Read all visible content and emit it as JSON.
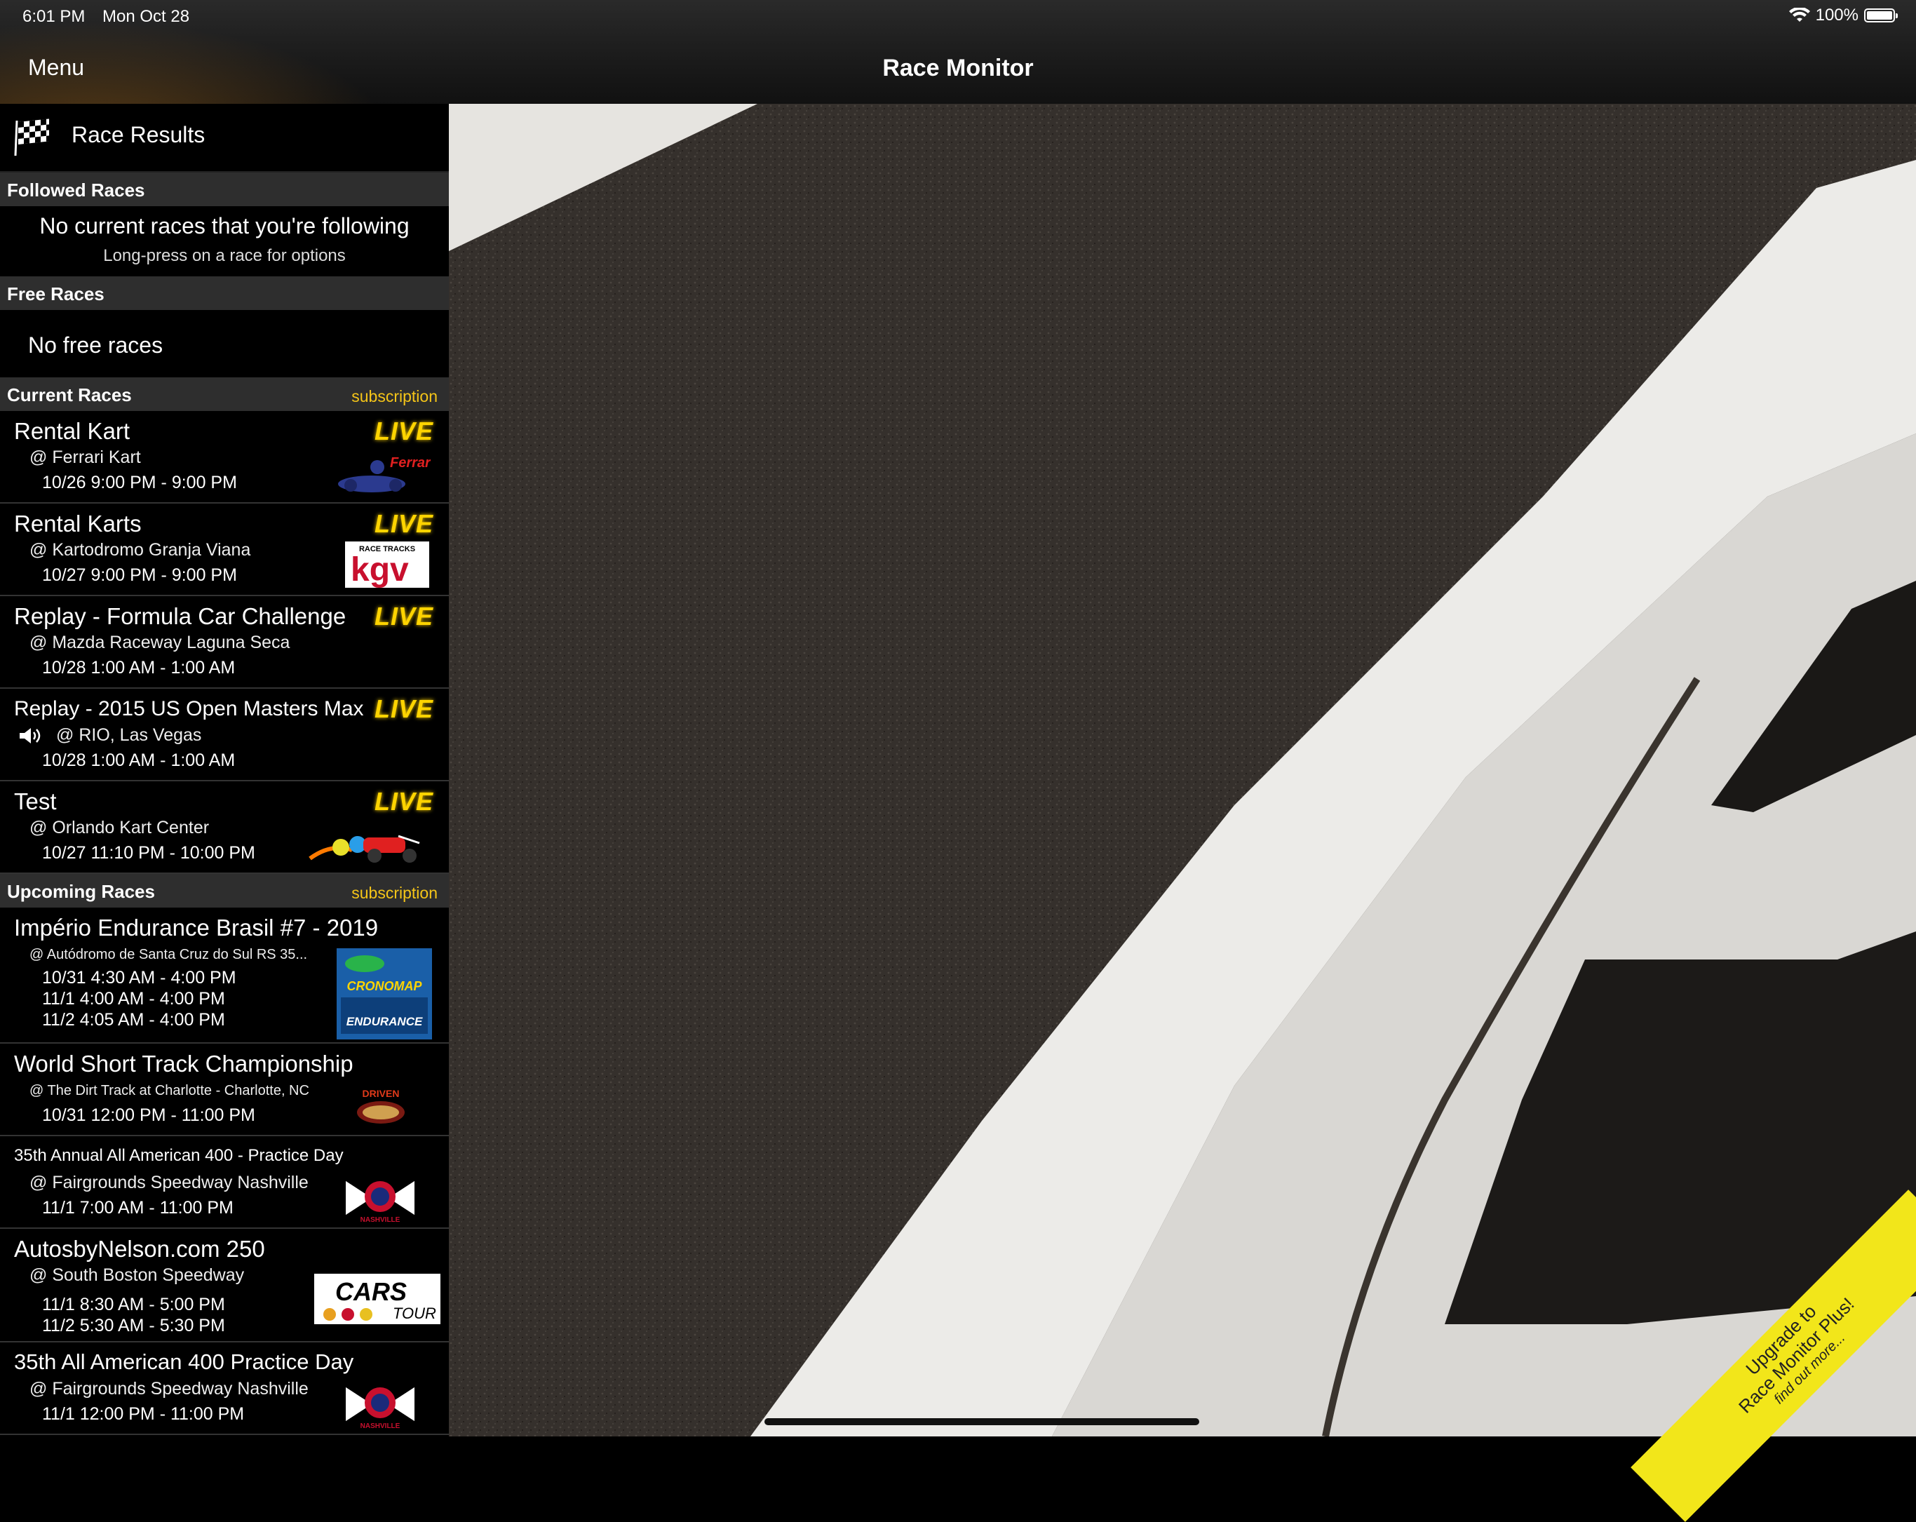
{
  "status": {
    "time": "6:01 PM",
    "date": "Mon Oct 28",
    "battery": "100%"
  },
  "nav": {
    "menu": "Menu",
    "title": "Race Monitor"
  },
  "sidebar": {
    "race_results": "Race Results",
    "followed": {
      "header": "Followed Races",
      "empty": "No current races that you're following",
      "hint": "Long-press on a race for options"
    },
    "free": {
      "header": "Free Races",
      "empty": "No free races"
    },
    "current": {
      "header": "Current Races",
      "sub": "subscription",
      "races": [
        {
          "name": "Rental Kart",
          "venue": "@ Ferrari Kart",
          "dates": [
            "10/26  9:00 PM - 9:00 PM"
          ],
          "live": "LIVE",
          "logo": "ferrari-kart-logo"
        },
        {
          "name": "Rental Karts",
          "venue": "@ Kartodromo Granja Viana",
          "dates": [
            "10/27  9:00 PM - 9:00 PM"
          ],
          "live": "LIVE",
          "logo": "kgv-logo"
        },
        {
          "name": "Replay - Formula Car Challenge",
          "venue": "@ Mazda Raceway Laguna Seca",
          "dates": [
            "10/28  1:00 AM - 1:00 AM"
          ],
          "live": "LIVE",
          "logo": ""
        },
        {
          "name": "Replay - 2015 US Open Masters Max",
          "venue": "@ RIO, Las Vegas",
          "dates": [
            "10/28  1:00 AM - 1:00 AM"
          ],
          "live": "LIVE",
          "logo": "",
          "speaker": "speaker-icon"
        },
        {
          "name": "Test",
          "venue": "@ Orlando Kart Center",
          "dates": [
            "10/27  11:10 PM - 10:00 PM"
          ],
          "live": "LIVE",
          "logo": "orlando-kart-logo"
        }
      ]
    },
    "upcoming": {
      "header": "Upcoming Races",
      "sub": "subscription",
      "races": [
        {
          "name": "Império Endurance Brasil #7 - 2019",
          "venue": "@ Autódromo de Santa Cruz do Sul RS 35...",
          "dates": [
            "10/31  4:30 AM - 4:00 PM",
            "11/1  4:00 AM - 4:00 PM",
            "11/2  4:05 AM - 4:00 PM"
          ],
          "logo": "cronomap-logo",
          "logo_text": "CRONOMAP",
          "logo_text2": "ENDURANCE"
        },
        {
          "name": "World Short Track Championship",
          "venue": "@ The Dirt Track at Charlotte - Charlotte, NC",
          "dates": [
            "10/31  12:00 PM - 11:00 PM"
          ],
          "logo": "driven-logo",
          "logo_text": "DRIVEN"
        },
        {
          "name": "35th Annual All American 400 - Practice Day",
          "venue": "@ Fairgrounds Speedway Nashville",
          "dates": [
            "11/1  7:00 AM - 11:00 PM"
          ],
          "logo": "fairgrounds-logo",
          "logo_text": "NASHVILLE"
        },
        {
          "name": "AutosbyNelson.com 250",
          "venue": "@ South Boston Speedway",
          "dates": [
            "11/1  8:30 AM - 5:00 PM",
            "11/2  5:30 AM - 5:30 PM"
          ],
          "logo": "cars-tour-logo",
          "logo_text": "CARS",
          "logo_text2": "TOUR"
        },
        {
          "name": "35th All American 400 Practice Day",
          "venue": "@ Fairgrounds Speedway Nashville",
          "dates": [
            "11/1  12:00 PM - 11:00 PM"
          ],
          "logo": "fairgrounds-logo",
          "logo_text": "NASHVILLE"
        }
      ]
    }
  },
  "upgrade": {
    "line1": "Upgrade to",
    "line2": "Race Monitor Plus!",
    "line3": "find out more..."
  },
  "logo_text": {
    "ferrari": "Ferrari Kart",
    "kgv_top": "RACE TRACKS",
    "kgv": "kgv"
  }
}
